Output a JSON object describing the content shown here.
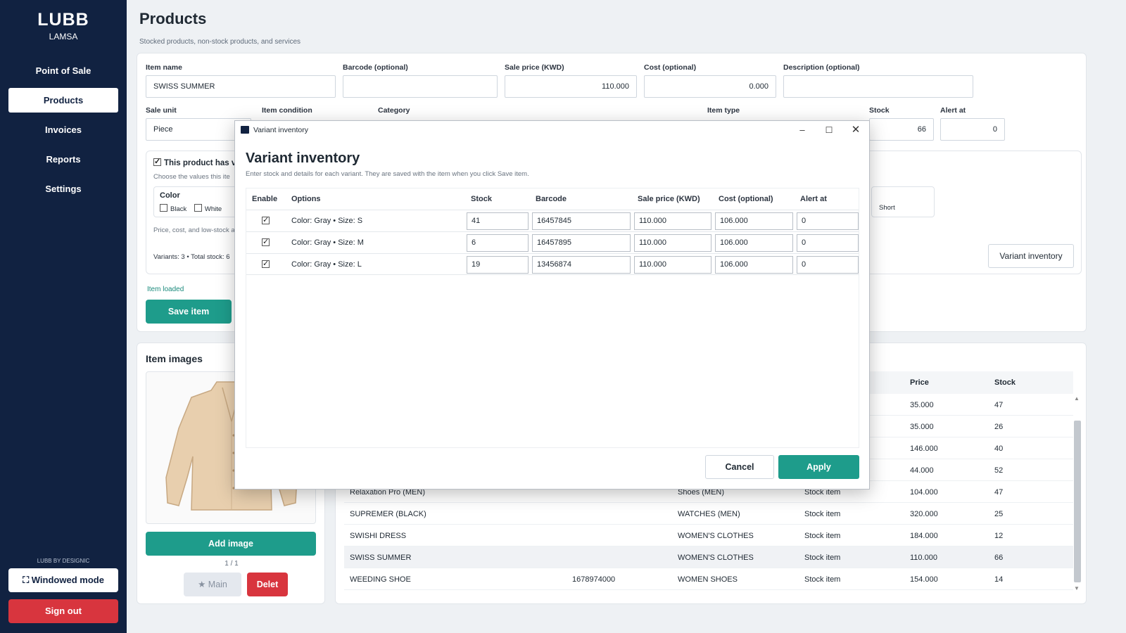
{
  "sidebar": {
    "brand_title": "LUBB",
    "brand_sub": "LAMSA",
    "items": [
      {
        "label": "Point of Sale"
      },
      {
        "label": "Products"
      },
      {
        "label": "Invoices"
      },
      {
        "label": "Reports"
      },
      {
        "label": "Settings"
      }
    ],
    "credit": "LUBB BY DESIGNIC",
    "windowed_label": "⛶ Windowed mode",
    "signout_label": "Sign out"
  },
  "page": {
    "title": "Products",
    "subtitle": "Stocked products, non-stock products, and services"
  },
  "form": {
    "item_name_label": "Item name",
    "item_name_value": "SWISS SUMMER",
    "barcode_label": "Barcode (optional)",
    "barcode_value": "",
    "sale_price_label": "Sale price (KWD)",
    "sale_price_value": "110.000",
    "cost_label": "Cost (optional)",
    "cost_value": "0.000",
    "description_label": "Description (optional)",
    "description_value": "",
    "sale_unit_label": "Sale unit",
    "sale_unit_value": "Piece",
    "item_condition_label": "Item condition",
    "category_label": "Category",
    "item_type_label": "Item type",
    "stock_label": "Stock",
    "stock_value": "66",
    "alert_label": "Alert at",
    "alert_value": "0",
    "variants_check_label": "This product has va",
    "variants_hint": "Choose the values this ite",
    "color_title": "Color",
    "color_options": [
      "Black",
      "White"
    ],
    "size_option_partial": "Short",
    "price_hint": "Price, cost, and low-stock al",
    "variants_summary": "Variants: 3 • Total stock: 6",
    "variant_inventory_label": "Variant inventory",
    "status": "Item loaded",
    "save_label": "Save item"
  },
  "images": {
    "title": "Item images",
    "add_label": "Add image",
    "count": "1 / 1",
    "main_label": "★ Main",
    "delete_label": "Delet"
  },
  "list": {
    "headers": {
      "price": "Price",
      "stock": "Stock"
    },
    "rows": [
      {
        "name": "",
        "barcode": "",
        "category": "",
        "type": "",
        "price": "35.000",
        "stock": "47"
      },
      {
        "name": "",
        "barcode": "",
        "category": "",
        "type": "",
        "price": "35.000",
        "stock": "26"
      },
      {
        "name": "",
        "barcode": "",
        "category": "",
        "type": "",
        "price": "146.000",
        "stock": "40"
      },
      {
        "name": "",
        "barcode": "",
        "category": "",
        "type": "",
        "price": "44.000",
        "stock": "52"
      },
      {
        "name": "Relaxation Pro (MEN)",
        "barcode": "",
        "category": "Shoes (MEN)",
        "type": "Stock item",
        "price": "104.000",
        "stock": "47"
      },
      {
        "name": "SUPREMER (BLACK)",
        "barcode": "",
        "category": "WATCHES (MEN)",
        "type": "Stock item",
        "price": "320.000",
        "stock": "25"
      },
      {
        "name": "SWISHI DRESS",
        "barcode": "",
        "category": "WOMEN'S CLOTHES",
        "type": "Stock item",
        "price": "184.000",
        "stock": "12"
      },
      {
        "name": "SWISS SUMMER",
        "barcode": "",
        "category": "WOMEN'S CLOTHES",
        "type": "Stock item",
        "price": "110.000",
        "stock": "66"
      },
      {
        "name": "WEEDING SHOE",
        "barcode": "1678974000",
        "category": "WOMEN SHOES",
        "type": "Stock item",
        "price": "154.000",
        "stock": "14"
      }
    ]
  },
  "dialog": {
    "window_title": "Variant inventory",
    "heading": "Variant inventory",
    "subtitle": "Enter stock and details for each variant. They are saved with the item when you click Save item.",
    "headers": {
      "enable": "Enable",
      "options": "Options",
      "stock": "Stock",
      "barcode": "Barcode",
      "sale_price": "Sale price (KWD)",
      "cost": "Cost (optional)",
      "alert": "Alert at"
    },
    "rows": [
      {
        "options": "Color: Gray • Size: S",
        "stock": "41",
        "barcode": "16457845",
        "sale_price": "110.000",
        "cost": "106.000",
        "alert": "0"
      },
      {
        "options": "Color: Gray • Size: M",
        "stock": "6",
        "barcode": "16457895",
        "sale_price": "110.000",
        "cost": "106.000",
        "alert": "0"
      },
      {
        "options": "Color: Gray • Size: L",
        "stock": "19",
        "barcode": "13456874",
        "sale_price": "110.000",
        "cost": "106.000",
        "alert": "0"
      }
    ],
    "cancel_label": "Cancel",
    "apply_label": "Apply"
  },
  "colors": {
    "sidebar_bg": "#112241",
    "accent": "#1e9c8b",
    "danger": "#d8353e"
  }
}
